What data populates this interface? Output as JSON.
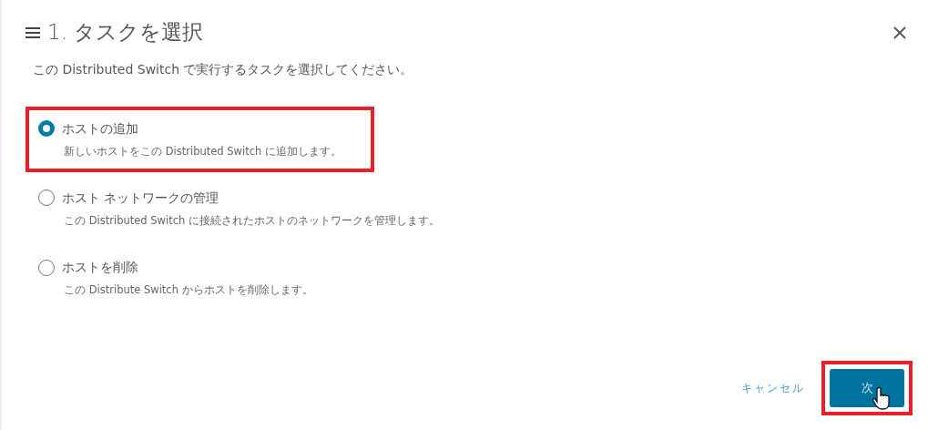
{
  "dialog": {
    "title": "1. タスクを選択",
    "subtitle": "この Distributed Switch で実行するタスクを選択してください。"
  },
  "options": [
    {
      "label": "ホストの追加",
      "description": "新しいホストをこの Distributed Switch に追加します。",
      "selected": true,
      "highlighted": true
    },
    {
      "label": "ホスト ネットワークの管理",
      "description": "この Distributed Switch に接続されたホストのネットワークを管理します。",
      "selected": false,
      "highlighted": false
    },
    {
      "label": "ホストを削除",
      "description": "この Distribute Switch からホストを削除します。",
      "selected": false,
      "highlighted": false
    }
  ],
  "footer": {
    "cancel": "キャンセル",
    "next": {
      "label": "次",
      "highlighted": true
    }
  }
}
